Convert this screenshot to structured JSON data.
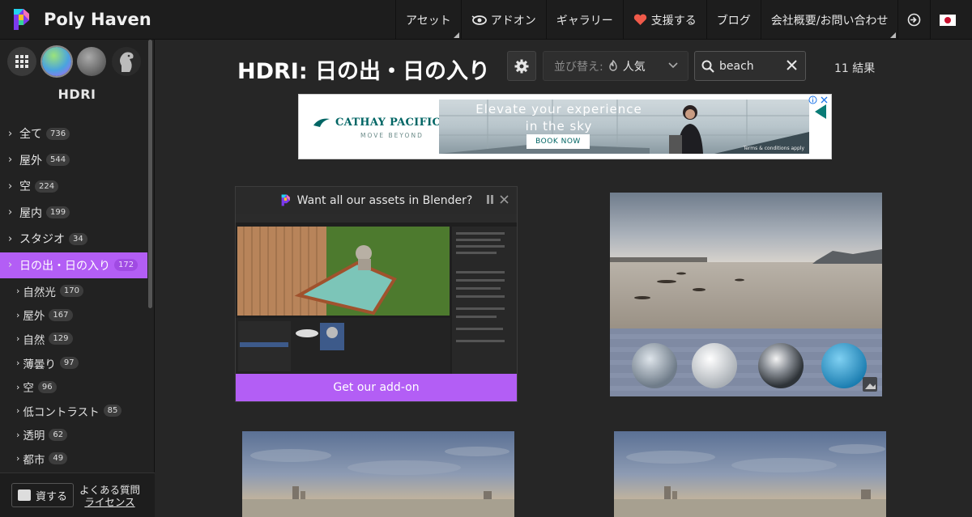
{
  "header": {
    "brand": "Poly Haven",
    "nav": [
      {
        "label": "アセット",
        "name": "nav-assets",
        "corner": true,
        "icon": ""
      },
      {
        "label": "アドオン",
        "name": "nav-addon",
        "corner": false,
        "icon": "eye-icon"
      },
      {
        "label": "ギャラリー",
        "name": "nav-gallery",
        "corner": false,
        "icon": ""
      },
      {
        "label": "支援する",
        "name": "nav-support",
        "corner": false,
        "icon": "heart-icon"
      },
      {
        "label": "ブログ",
        "name": "nav-blog",
        "corner": false,
        "icon": ""
      },
      {
        "label": "会社概要/お問い合わせ",
        "name": "nav-about",
        "corner": true,
        "icon": ""
      }
    ],
    "login_icon": "login-icon",
    "language": "ja",
    "language_icon": "japan-flag-icon"
  },
  "sidebar": {
    "category_title": "HDRI",
    "category_icons": [
      "grid-icon",
      "hdri-icon",
      "texture-icon",
      "model-icon"
    ],
    "items": [
      {
        "label": "全て",
        "count": "736"
      },
      {
        "label": "屋外",
        "count": "544"
      },
      {
        "label": "空",
        "count": "224"
      },
      {
        "label": "屋内",
        "count": "199"
      },
      {
        "label": "スタジオ",
        "count": "34"
      },
      {
        "label": "日の出・日の入り",
        "count": "172",
        "active": true
      }
    ],
    "subitems": [
      {
        "label": "自然光",
        "count": "170"
      },
      {
        "label": "屋外",
        "count": "167"
      },
      {
        "label": "自然",
        "count": "129"
      },
      {
        "label": "薄曇り",
        "count": "97"
      },
      {
        "label": "空",
        "count": "96"
      },
      {
        "label": "低コントラスト",
        "count": "85"
      },
      {
        "label": "透明",
        "count": "62"
      },
      {
        "label": "都市",
        "count": "49"
      }
    ],
    "footer": {
      "resources_label": "資する",
      "faq_label": "よくある質問",
      "license_label": "ライセンス"
    }
  },
  "main": {
    "title": "HDRI: 日の出・日の入り",
    "sort_label": "並び替え:",
    "sort_value": "人気",
    "search_value": "beach",
    "results": "11 結果"
  },
  "ad": {
    "brand": "CATHAY PACIFIC",
    "tagline": "MOVE BEYOND",
    "headline_1": "Elevate your experience",
    "headline_2": "in the sky",
    "cta": "BOOK NOW",
    "terms": "Terms & conditions apply"
  },
  "promo": {
    "title": "Want all our assets in Blender?",
    "button": "Get our add-on"
  },
  "colors": {
    "accent": "#b35ef5",
    "background": "#262626",
    "header": "#1d1d1d",
    "ad_brand": "#006564"
  }
}
